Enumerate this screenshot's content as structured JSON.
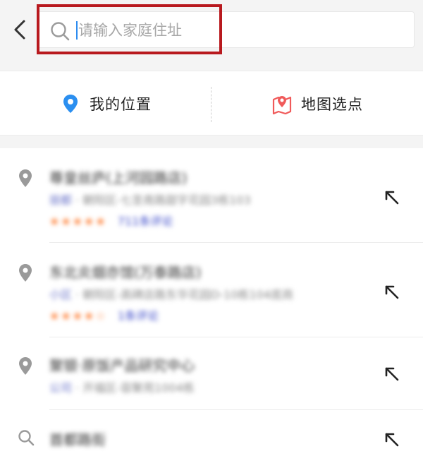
{
  "header": {
    "search": {
      "placeholder": "请输入家庭住址",
      "value": ""
    }
  },
  "location_options": {
    "my_location": {
      "label": "我的位置",
      "icon": "location-pin-icon"
    },
    "map_pick": {
      "label": "地图选点",
      "icon": "map-pin-icon"
    }
  },
  "results": [
    {
      "icon": "place-pin-icon",
      "title": "尊皇丝庐(上河园路店)",
      "tag": "丽都",
      "address": "· 朝阳区-七圣南路甜字花园3栋103",
      "stars": "★★★★★",
      "reviews": "711条评论"
    },
    {
      "icon": "place-pin-icon",
      "title": "东北炎烟亦馆(万泰路店)",
      "tag": "小区",
      "address": "· 朝阳区-高碑店路东华花园D-10栋104底商",
      "stars": "★★★★☆",
      "reviews": "1条评论"
    },
    {
      "icon": "place-pin-icon",
      "title": "聚银·原饭产品研究中心",
      "tag": "公司",
      "address": "· 开福区-容聚苑1004栋",
      "stars": "",
      "reviews": ""
    },
    {
      "icon": "search-icon",
      "title": "首都路街",
      "tag": "",
      "address": "",
      "stars": "",
      "reviews": ""
    }
  ],
  "colors": {
    "highlight_border": "#b8191e",
    "my_location_icon": "#2b8ff0",
    "map_pick_icon": "#f05a5a",
    "star": "#ff7a2e",
    "review_link": "#3b49c9"
  }
}
